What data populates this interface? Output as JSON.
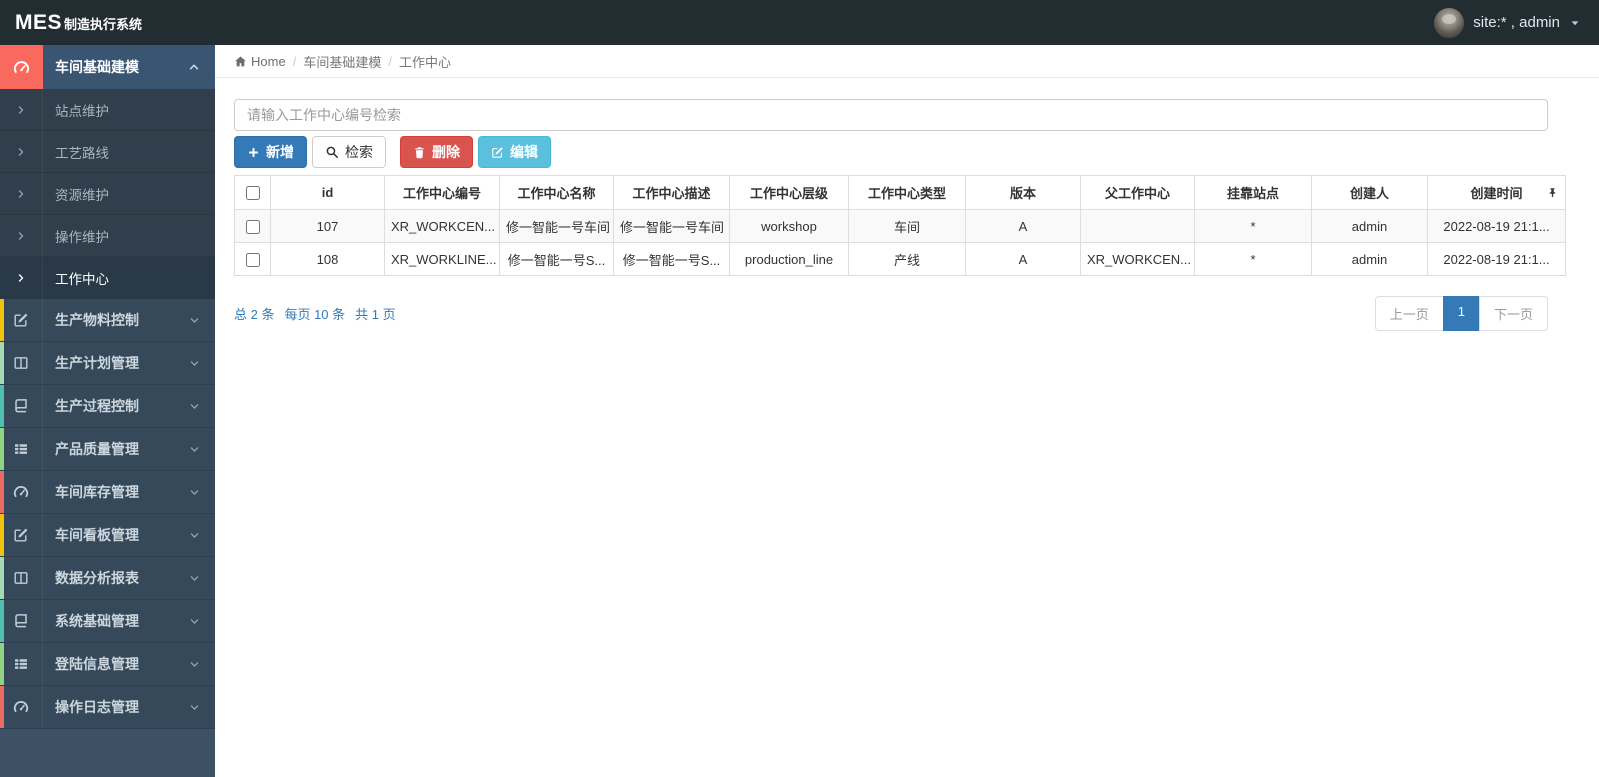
{
  "navbar": {
    "brand_bold": "MES",
    "brand_rest": "制造执行系统",
    "user_label": "site:* , admin"
  },
  "breadcrumb": {
    "home": "Home",
    "section": "车间基础建模",
    "page": "工作中心"
  },
  "search": {
    "placeholder": "请输入工作中心编号检索"
  },
  "toolbar": {
    "buttons": [
      {
        "label": "新增",
        "icon": "plus-icon",
        "style": "primary"
      },
      {
        "label": "检索",
        "icon": "search-icon",
        "style": "default"
      },
      {
        "label": "删除",
        "icon": "trash-icon",
        "style": "danger"
      },
      {
        "label": "编辑",
        "icon": "edit-icon",
        "style": "info"
      }
    ]
  },
  "sidebar": {
    "group": {
      "label": "车间基础建模",
      "icon": "gauge-icon",
      "accent": "#f9695e",
      "expanded": true
    },
    "subitems": [
      {
        "label": "站点维护",
        "active": false
      },
      {
        "label": "工艺路线",
        "active": false
      },
      {
        "label": "资源维护",
        "active": false
      },
      {
        "label": "操作维护",
        "active": false
      },
      {
        "label": "工作中心",
        "active": true
      }
    ],
    "items": [
      {
        "label": "生产物料控制",
        "icon": "pencil-square-icon",
        "accent": "#f0c20c"
      },
      {
        "label": "生产计划管理",
        "icon": "columns-icon",
        "accent": "#a5d9b0"
      },
      {
        "label": "生产过程控制",
        "icon": "book-icon",
        "accent": "#4fc0b0"
      },
      {
        "label": "产品质量管理",
        "icon": "list-icon",
        "accent": "#8fd383"
      },
      {
        "label": "车间库存管理",
        "icon": "gauge-icon",
        "accent": "#e96b63"
      },
      {
        "label": "车间看板管理",
        "icon": "pencil-square-icon",
        "accent": "#f0c20c"
      },
      {
        "label": "数据分析报表",
        "icon": "columns-icon",
        "accent": "#a5d9b0"
      },
      {
        "label": "系统基础管理",
        "icon": "book-icon",
        "accent": "#4fc0b0"
      },
      {
        "label": "登陆信息管理",
        "icon": "list-icon",
        "accent": "#8fd383"
      },
      {
        "label": "操作日志管理",
        "icon": "gauge-icon",
        "accent": "#e96b63"
      }
    ]
  },
  "table": {
    "columns": [
      "id",
      "工作中心编号",
      "工作中心名称",
      "工作中心描述",
      "工作中心层级",
      "工作中心类型",
      "版本",
      "父工作中心",
      "挂靠站点",
      "创建人",
      "创建时间"
    ],
    "rows": [
      [
        "107",
        "XR_WORKCEN...",
        "修一智能一号车间",
        "修一智能一号车间",
        "workshop",
        "车间",
        "A",
        "",
        "*",
        "admin",
        "2022-08-19 21:1..."
      ],
      [
        "108",
        "XR_WORKLINE...",
        "修一智能一号S...",
        "修一智能一号S...",
        "production_line",
        "产线",
        "A",
        "XR_WORKCEN...",
        "*",
        "admin",
        "2022-08-19 21:1..."
      ]
    ]
  },
  "pagination": {
    "total": "总 2 条",
    "per_page": "每页 10 条",
    "pages": "共 1 页",
    "prev": "上一页",
    "current": "1",
    "next": "下一页"
  },
  "colors": {
    "primary": "#337ab7",
    "danger": "#d9534f",
    "info": "#5bc0de",
    "navbar_bg": "#222d32",
    "sidebar_bg": "#36495b",
    "group_accent": "#f9695e"
  }
}
